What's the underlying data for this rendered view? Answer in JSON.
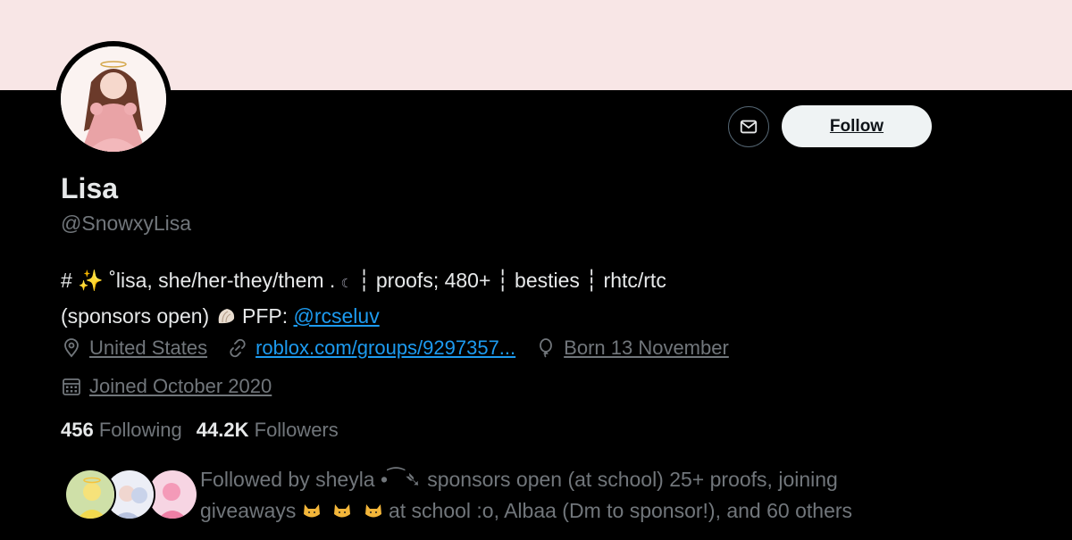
{
  "profile": {
    "display_name": "Lisa",
    "handle": "@SnowxyLisa",
    "bio_line1_prefix": "# ✨ ˚lisa, she/her-they/them . ",
    "bio_line1_suffix": " ┆ proofs; 480+  ┆ besties ┆ rhtc/rtc",
    "bio_line2_prefix": "(sponsors open) ",
    "bio_pfp_label": " PFP: ",
    "bio_pfp_link": "@rcseluv",
    "location": "United States",
    "website": "roblox.com/groups/9297357...",
    "birthday": "Born 13 November",
    "joined": "Joined October 2020"
  },
  "actions": {
    "follow_label": "Follow"
  },
  "stats": {
    "following_count": "456",
    "following_label": "Following",
    "followers_count": "44.2K",
    "followers_label": "Followers"
  },
  "followed_by": {
    "line1": "Followed by sheyla •⁀➴ sponsors open (at school) 25+ proofs, joining",
    "line2_prefix": "giveaways",
    "line2_suffix": " at school :o, Albaa (Dm to sponsor!), and 60 others"
  },
  "colors": {
    "banner": "#f8e6e6",
    "link": "#1d9bf0",
    "muted": "#71767b",
    "text": "#e7e9ea"
  },
  "icons": [
    "mail-icon",
    "location-pin-icon",
    "link-icon",
    "balloon-icon",
    "calendar-icon",
    "shell-icon",
    "moon-icon",
    "cat-face-icon"
  ]
}
